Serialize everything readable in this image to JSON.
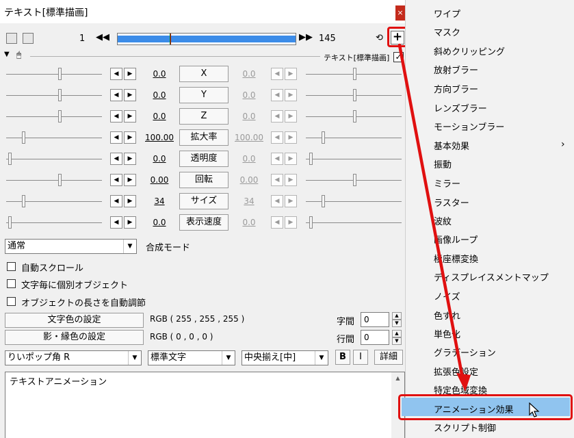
{
  "window": {
    "title": "テキスト[標準描画]",
    "close_label": "×"
  },
  "toolbar": {
    "frame_start": "1",
    "frame_end": "145",
    "prev_btn": "◀◀",
    "next_btn": "▶▶",
    "add_filter_label": "+"
  },
  "section": {
    "label": "テキスト[標準描画]",
    "checked": "✓"
  },
  "params": [
    {
      "name": "X",
      "left": "0.0",
      "right": "0.0"
    },
    {
      "name": "Y",
      "left": "0.0",
      "right": "0.0"
    },
    {
      "name": "Z",
      "left": "0.0",
      "right": "0.0"
    },
    {
      "name": "拡大率",
      "left": "100.00",
      "right": "100.00"
    },
    {
      "name": "透明度",
      "left": "0.0",
      "right": "0.0"
    },
    {
      "name": "回転",
      "left": "0.00",
      "right": "0.00"
    },
    {
      "name": "サイズ",
      "left": "34",
      "right": "34"
    },
    {
      "name": "表示速度",
      "left": "0.0",
      "right": "0.0"
    }
  ],
  "blend": {
    "value": "通常",
    "label": "合成モード"
  },
  "checks": [
    {
      "label": "自動スクロール"
    },
    {
      "label": "文字毎に個別オブジェクト"
    },
    {
      "label": "オブジェクトの長さを自動調節"
    }
  ],
  "colors": {
    "text_btn": "文字色の設定",
    "text_rgb": "RGB ( 255 , 255 , 255 )",
    "shadow_btn": "影・縁色の設定",
    "shadow_rgb": "RGB ( 0 , 0 , 0 )",
    "char_spacing_label": "字間",
    "char_spacing": "0",
    "line_spacing_label": "行間",
    "line_spacing": "0"
  },
  "font": {
    "family": "りいポップ角 R",
    "style": "標準文字",
    "align": "中央揃え[中]",
    "bold": "B",
    "italic": "I",
    "detail": "詳細"
  },
  "text_content": "テキストアニメーション",
  "menu": {
    "items": [
      "ワイプ",
      "マスク",
      "斜めクリッピング",
      "放射ブラー",
      "方向ブラー",
      "レンズブラー",
      "モーションブラー",
      "基本効果",
      "振動",
      "ミラー",
      "ラスター",
      "波紋",
      "画像ループ",
      "極座標変換",
      "ディスプレイスメントマップ",
      "ノイズ",
      "色ずれ",
      "単色化",
      "グラデーション",
      "拡張色設定",
      "特定色域変換",
      "アニメーション効果",
      "スクリプト制御"
    ],
    "submenu_arrow": "›",
    "highlighted_index": 21
  },
  "accent": {
    "highlight": "#90c4ef",
    "annotation_red": "#e01010",
    "seek_blue": "#3c8ce8"
  }
}
